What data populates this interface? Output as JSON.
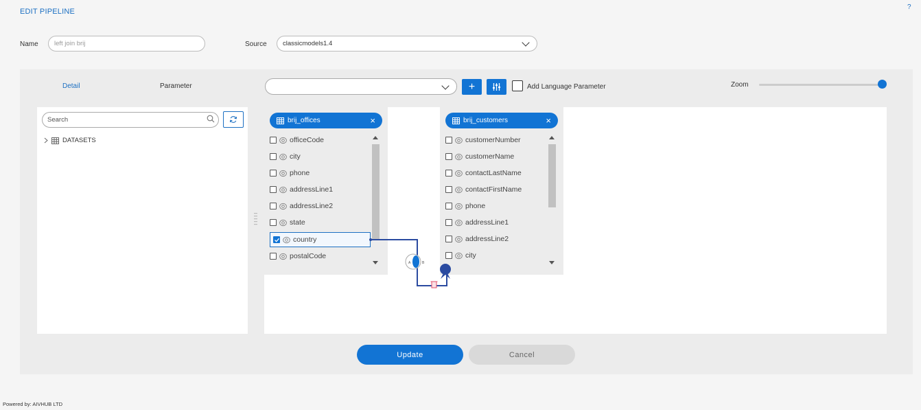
{
  "header": {
    "title": "EDIT PIPELINE",
    "help": "?"
  },
  "form": {
    "name_label": "Name",
    "name_placeholder": "left join brij",
    "source_label": "Source",
    "source_value": "classicmodels1.4"
  },
  "tabs": {
    "detail": "Detail",
    "parameter": "Parameter"
  },
  "toolbar": {
    "add_symbol": "+",
    "add_language_label": "Add Language Parameter",
    "zoom_label": "Zoom",
    "zoom_level": 1.0
  },
  "sidebar": {
    "search_placeholder": "Search",
    "tree": [
      {
        "label": "DATASETS",
        "expanded": false
      }
    ]
  },
  "tables": [
    {
      "name": "brij_offices",
      "close": "×",
      "fields": [
        {
          "label": "officeCode",
          "checked": false
        },
        {
          "label": "city",
          "checked": false
        },
        {
          "label": "phone",
          "checked": false
        },
        {
          "label": "addressLine1",
          "checked": false
        },
        {
          "label": "addressLine2",
          "checked": false
        },
        {
          "label": "state",
          "checked": false
        },
        {
          "label": "country",
          "checked": true
        },
        {
          "label": "postalCode",
          "checked": false
        }
      ]
    },
    {
      "name": "brij_customers",
      "close": "×",
      "fields": [
        {
          "label": "customerNumber",
          "checked": false
        },
        {
          "label": "customerName",
          "checked": false
        },
        {
          "label": "contactLastName",
          "checked": false
        },
        {
          "label": "contactFirstName",
          "checked": false
        },
        {
          "label": "phone",
          "checked": false
        },
        {
          "label": "addressLine1",
          "checked": false
        },
        {
          "label": "addressLine2",
          "checked": false
        },
        {
          "label": "city",
          "checked": false
        }
      ]
    }
  ],
  "join": {
    "left_letter": "A",
    "right_letter": "B"
  },
  "actions": {
    "update": "Update",
    "cancel": "Cancel"
  },
  "footer": {
    "text": "Powered by: AIVHUB LTD"
  },
  "colors": {
    "accent": "#1274d4",
    "link": "#1b6fc2",
    "connector": "#2a4aa0",
    "delete": "#e0506a"
  },
  "icons": [
    "question-icon",
    "chevron-down-icon",
    "plus-icon",
    "sliders-icon",
    "search-icon",
    "refresh-icon",
    "chevron-right-icon",
    "table-icon",
    "close-icon",
    "eye-icon",
    "checkbox-icon",
    "join-icon",
    "trash-icon",
    "pin-icon"
  ]
}
